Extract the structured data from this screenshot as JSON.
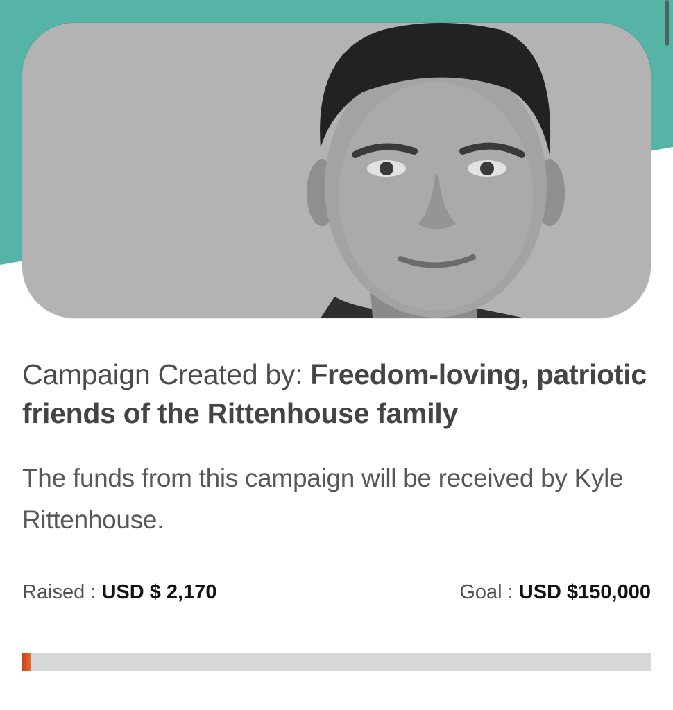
{
  "colors": {
    "teal": "#56b4a6",
    "progress_fill": "#d5511f",
    "progress_track": "#d7d7d7"
  },
  "hero": {
    "image_alt": "Kyle Rittenhouse portrait"
  },
  "campaign": {
    "creator_prefix": "Campaign Created by: ",
    "creator_name": "Freedom-loving, patriotic friends of the Rittenhouse family",
    "recipient_text": "The funds from this campaign will be received by Kyle Rittenhouse."
  },
  "stats": {
    "raised_label": "Raised : ",
    "raised_value": "USD $ 2,170",
    "goal_label": "Goal : ",
    "goal_value": "USD $150,000",
    "progress_fraction": 0.0145
  }
}
